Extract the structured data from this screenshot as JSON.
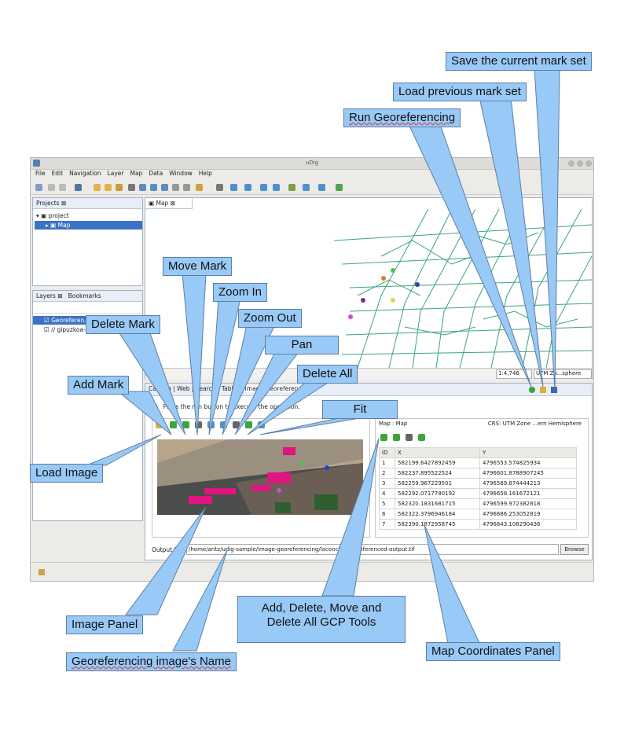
{
  "window": {
    "title": "uDig"
  },
  "menu": [
    "File",
    "Edit",
    "Navigation",
    "Layer",
    "Map",
    "Data",
    "Window",
    "Help"
  ],
  "projects_panel": {
    "tab": "Projects",
    "items": [
      "project",
      "Map"
    ]
  },
  "layers_panel": {
    "tabs": [
      "Layers",
      "Bookmarks"
    ],
    "items": [
      "Georeferen...",
      "gipuzkoa-roads"
    ]
  },
  "map_editor": {
    "tab": "Map",
    "scale": "1:4,746",
    "crs": "UTM Zo...sphere"
  },
  "bottom_tabs": [
    "Catalog",
    "Web",
    "Search",
    "Table",
    "Image Georeferencing"
  ],
  "info_text": "Press the run button to execute the operation.",
  "map_coords": {
    "title": "Map : Map",
    "crs": "CRS: UTM Zone ...ern Hemisphere",
    "columns": [
      "ID",
      "X",
      "Y"
    ],
    "rows": [
      [
        "1",
        "582199.6427892459",
        "4796553.574825934"
      ],
      [
        "2",
        "582237.895522524",
        "4796601.8788907245"
      ],
      [
        "3",
        "582259.967229501",
        "4796589.874444213"
      ],
      [
        "4",
        "582292.0717780192",
        "4796658.161672121"
      ],
      [
        "5",
        "582320.1831681715",
        "4796599.972382818"
      ],
      [
        "6",
        "582322.3796946184",
        "4796686.253052819"
      ],
      [
        "7",
        "582390.1872958745",
        "4796643.108290436"
      ]
    ]
  },
  "output": {
    "label": "Output file:",
    "value": "/home/aritz/udig-sample/image-georeferencing/laconcha-georeferenced-output.tif",
    "browse": "Browse"
  },
  "callouts": {
    "save": "Save the current mark set",
    "load": "Load previous mark set",
    "run": "Run Georeferencing",
    "move": "Move Mark",
    "zoom_in": "Zoom In",
    "zoom_out": "Zoom Out",
    "delete_mark": "Delete Mark",
    "pan": "Pan",
    "delete_all": "Delete All",
    "add_mark": "Add Mark",
    "fit": "Fit",
    "load_image": "Load Image",
    "image_panel": "Image Panel",
    "gcp_tools": "Add, Delete, Move and Delete All GCP Tools",
    "map_coords": "Map Coordinates Panel",
    "image_name": "Georeferencing image's Name"
  },
  "colors": {
    "callout": "#99c9f6",
    "road": "#3aa57a",
    "selection": "#3b73c4"
  }
}
